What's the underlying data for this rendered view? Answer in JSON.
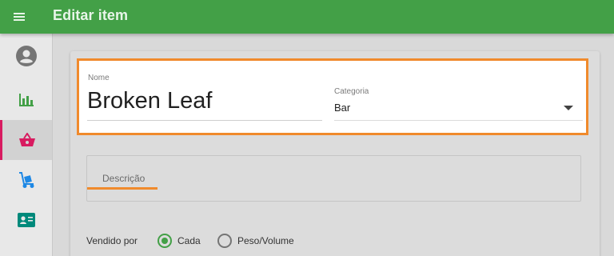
{
  "appbar": {
    "title": "Editar item"
  },
  "sidebar": {
    "items": [
      {
        "icon": "account-icon",
        "color": "#757575",
        "active": false
      },
      {
        "icon": "bar-chart-icon",
        "color": "#43a047",
        "active": false
      },
      {
        "icon": "basket-icon",
        "color": "#d81b60",
        "active": true
      },
      {
        "icon": "hand-truck-icon",
        "color": "#1e88e5",
        "active": false
      },
      {
        "icon": "contact-card-icon",
        "color": "#00897b",
        "active": false
      }
    ]
  },
  "form": {
    "nome": {
      "label": "Nome",
      "value": "Broken Leaf"
    },
    "categoria": {
      "label": "Categoria",
      "value": "Bar"
    },
    "descricao": {
      "label": "Descrição"
    },
    "vendido_por": {
      "label": "Vendido por",
      "options": [
        {
          "label": "Cada",
          "selected": true
        },
        {
          "label": "Peso/Volume",
          "selected": false
        }
      ]
    }
  },
  "colors": {
    "primary": "#43a047",
    "accent_highlight": "#f08a2c",
    "active_indicator": "#d81b60"
  }
}
